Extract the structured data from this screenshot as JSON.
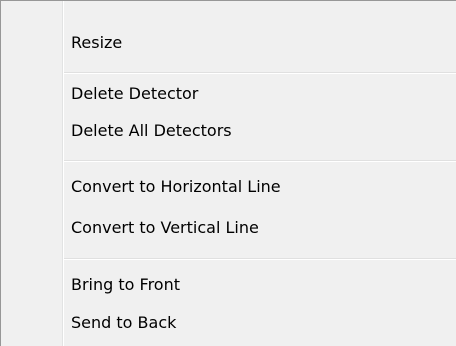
{
  "context_menu": {
    "items": [
      {
        "label": "Resize"
      },
      {
        "label": "Delete Detector"
      },
      {
        "label": "Delete All Detectors"
      },
      {
        "label": "Convert to Horizontal Line"
      },
      {
        "label": "Convert to Vertical Line"
      },
      {
        "label": "Bring to Front"
      },
      {
        "label": "Send to Back"
      }
    ]
  },
  "colors": {
    "menu_background": "#f0f0f0",
    "border": "#979797",
    "separator": "#e0e0e0"
  }
}
